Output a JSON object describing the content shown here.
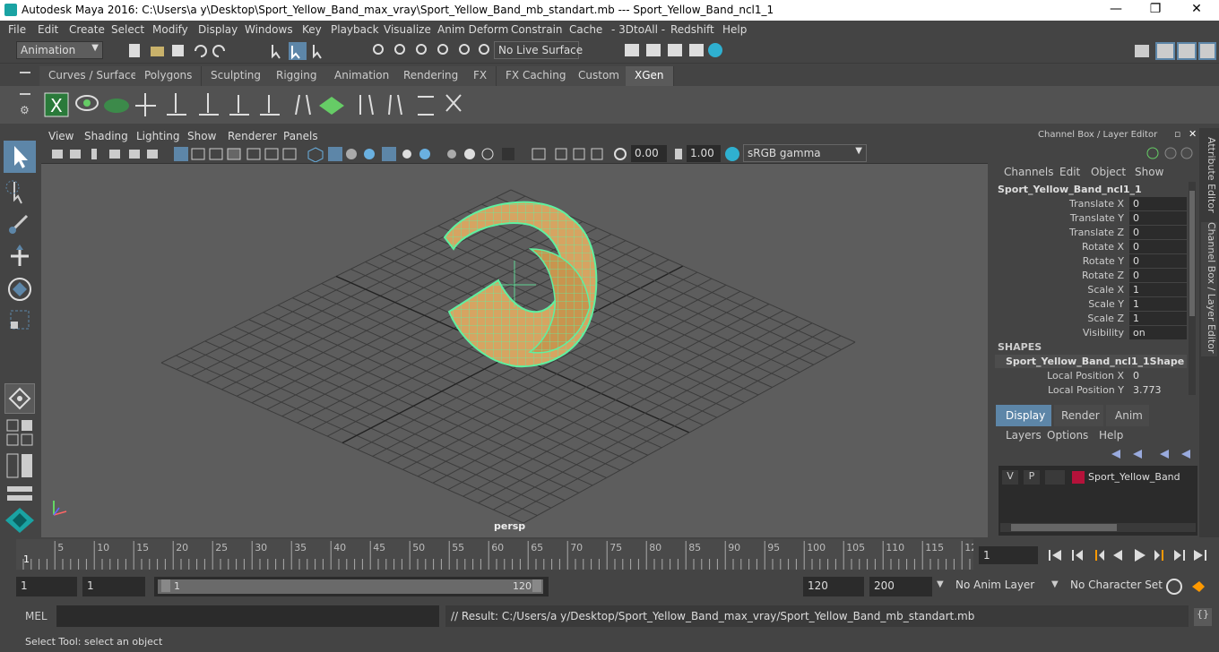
{
  "window": {
    "title": "Autodesk Maya 2016: C:\\Users\\a y\\Desktop\\Sport_Yellow_Band_max_vray\\Sport_Yellow_Band_mb_standart.mb   ---   Sport_Yellow_Band_ncl1_1",
    "minimize": "—",
    "maximize": "❐",
    "close": "✕"
  },
  "menu": [
    "File",
    "Edit",
    "Create",
    "Select",
    "Modify",
    "Display",
    "Windows",
    "Key",
    "Playback",
    "Visualize",
    "Anim Deform",
    "Constrain",
    "Cache",
    "- 3DtoAll -",
    "Redshift",
    "Help"
  ],
  "statusline": {
    "menuset": "Animation",
    "live_surface": "No Live Surface"
  },
  "shelf": {
    "tabs": [
      "Curves / Surfaces",
      "Polygons",
      "Sculpting",
      "Rigging",
      "Animation",
      "Rendering",
      "FX",
      "FX Caching",
      "Custom",
      "XGen"
    ],
    "active_tab": "XGen"
  },
  "viewport": {
    "menu": [
      "View",
      "Shading",
      "Lighting",
      "Show",
      "Renderer",
      "Panels"
    ],
    "exposure": "0.00",
    "gamma": "1.00",
    "colorspace": "sRGB gamma",
    "camera_label": "persp",
    "wire_color": "#5ff0a0"
  },
  "channel_box": {
    "header": "Channel Box / Layer Editor",
    "menu": [
      "Channels",
      "Edit",
      "Object",
      "Show"
    ],
    "object_name": "Sport_Yellow_Band_ncl1_1",
    "attributes": [
      {
        "label": "Translate X",
        "value": "0"
      },
      {
        "label": "Translate Y",
        "value": "0"
      },
      {
        "label": "Translate Z",
        "value": "0"
      },
      {
        "label": "Rotate X",
        "value": "0"
      },
      {
        "label": "Rotate Y",
        "value": "0"
      },
      {
        "label": "Rotate Z",
        "value": "0"
      },
      {
        "label": "Scale X",
        "value": "1"
      },
      {
        "label": "Scale Y",
        "value": "1"
      },
      {
        "label": "Scale Z",
        "value": "1"
      },
      {
        "label": "Visibility",
        "value": "on"
      }
    ],
    "shapes_header": "SHAPES",
    "shape_name": "Sport_Yellow_Band_ncl1_1Shape",
    "shape_attributes": [
      {
        "label": "Local Position X",
        "value": "0"
      },
      {
        "label": "Local Position Y",
        "value": "3.773"
      }
    ]
  },
  "layer_editor": {
    "tabs": [
      "Display",
      "Render",
      "Anim"
    ],
    "active_tab": "Display",
    "menu": [
      "Layers",
      "Options",
      "Help"
    ],
    "layer": {
      "v": "V",
      "p": "P",
      "name": "Sport_Yellow_Band",
      "color": "#b5123a"
    }
  },
  "side_tabs": [
    "Attribute Editor",
    "Channel Box / Layer Editor"
  ],
  "timeline": {
    "ticks": [
      "5",
      "10",
      "15",
      "20",
      "25",
      "30",
      "35",
      "40",
      "45",
      "50",
      "55",
      "60",
      "65",
      "70",
      "75",
      "80",
      "85",
      "90",
      "95",
      "100",
      "105",
      "110",
      "115",
      "12"
    ],
    "current_frame_marker": "1",
    "current_frame": "1"
  },
  "range": {
    "start": "1",
    "anim_start": "1",
    "slider_start": "1",
    "slider_end": "120",
    "end": "120",
    "anim_end": "200",
    "anim_layer": "No Anim Layer",
    "character_set": "No Character Set"
  },
  "command": {
    "mel_label": "MEL",
    "result": "// Result: C:/Users/a y/Desktop/Sport_Yellow_Band_max_vray/Sport_Yellow_Band_mb_standart.mb"
  },
  "help_line": "Select Tool: select an object"
}
